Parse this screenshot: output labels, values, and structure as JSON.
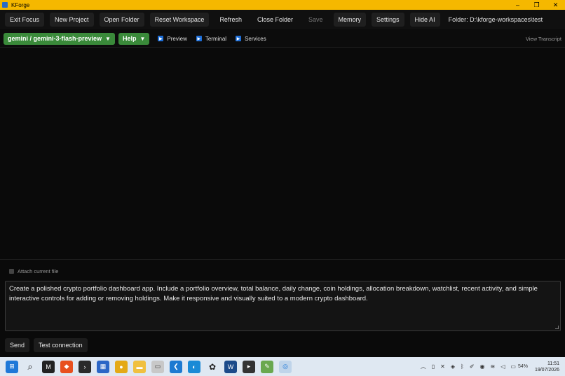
{
  "window": {
    "title": "KForge",
    "controls": [
      "–",
      "❐",
      "✕"
    ]
  },
  "toolbar": {
    "buttons": [
      {
        "label": "Exit Focus"
      },
      {
        "label": "New Project"
      },
      {
        "label": "Open Folder"
      },
      {
        "label": "Reset Workspace"
      },
      {
        "label": "Refresh"
      },
      {
        "label": "Close Folder"
      },
      {
        "label": "Save"
      },
      {
        "label": "Memory"
      },
      {
        "label": "Settings"
      },
      {
        "label": "Hide AI"
      }
    ],
    "folder_label": "Folder: D:\\kforge-workspaces\\test"
  },
  "subbar": {
    "model_select": "gemini / gemini-3-flash-preview",
    "help_label": "Help",
    "preview_label": "Preview",
    "terminal_label": "Terminal",
    "services_label": "Services",
    "transcript_label": "View Transcript"
  },
  "chat": {
    "attach_label": "Attach current file",
    "prompt_text": "Create a polished crypto portfolio dashboard app. Include a portfolio overview, total balance, daily change, coin holdings, allocation breakdown, watchlist, recent activity, and simple interactive controls for adding or removing holdings. Make it responsive and visually suited to a modern crypto dashboard.",
    "send_label": "Send",
    "test_label": "Test connection"
  },
  "taskbar": {
    "battery": "54%",
    "time": "11:51",
    "date": "19/07/2026"
  }
}
